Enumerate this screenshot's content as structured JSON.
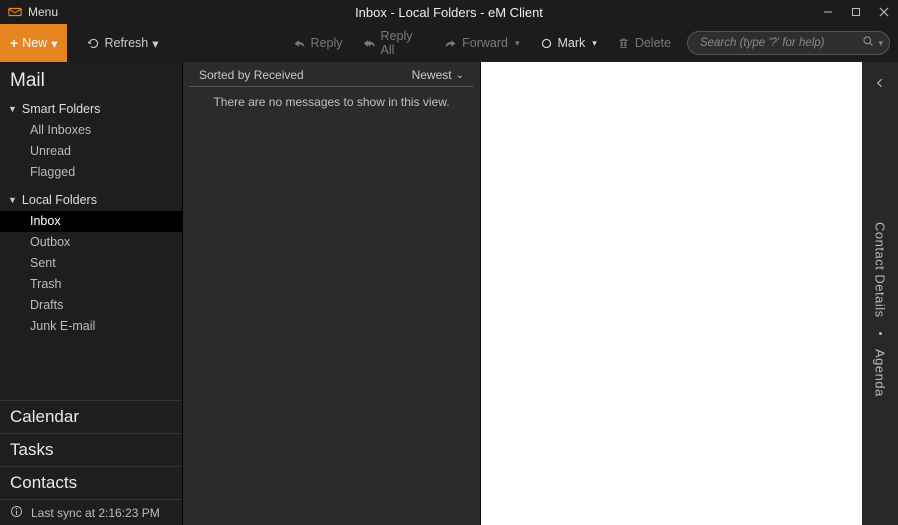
{
  "titlebar": {
    "menu_label": "Menu",
    "window_title": "Inbox - Local Folders - eM Client"
  },
  "toolbar": {
    "new_label": "New",
    "refresh_label": "Refresh",
    "reply_label": "Reply",
    "reply_all_label": "Reply All",
    "forward_label": "Forward",
    "mark_label": "Mark",
    "delete_label": "Delete"
  },
  "search": {
    "placeholder": "Search (type '?' for help)"
  },
  "sidebar": {
    "mail_label": "Mail",
    "smart_folders_label": "Smart Folders",
    "smart_folders": [
      {
        "label": "All Inboxes"
      },
      {
        "label": "Unread"
      },
      {
        "label": "Flagged"
      }
    ],
    "local_folders_label": "Local Folders",
    "local_folders": [
      {
        "label": "Inbox"
      },
      {
        "label": "Outbox"
      },
      {
        "label": "Sent"
      },
      {
        "label": "Trash"
      },
      {
        "label": "Drafts"
      },
      {
        "label": "Junk E-mail"
      }
    ],
    "calendar_label": "Calendar",
    "tasks_label": "Tasks",
    "contacts_label": "Contacts"
  },
  "status": {
    "last_sync": "Last sync at 2:16:23 PM"
  },
  "msglist": {
    "sort_label": "Sorted by Received",
    "sort_order": "Newest",
    "empty_text": "There are no messages to show in this view."
  },
  "rail": {
    "contact_details": "Contact Details",
    "agenda": "Agenda"
  }
}
